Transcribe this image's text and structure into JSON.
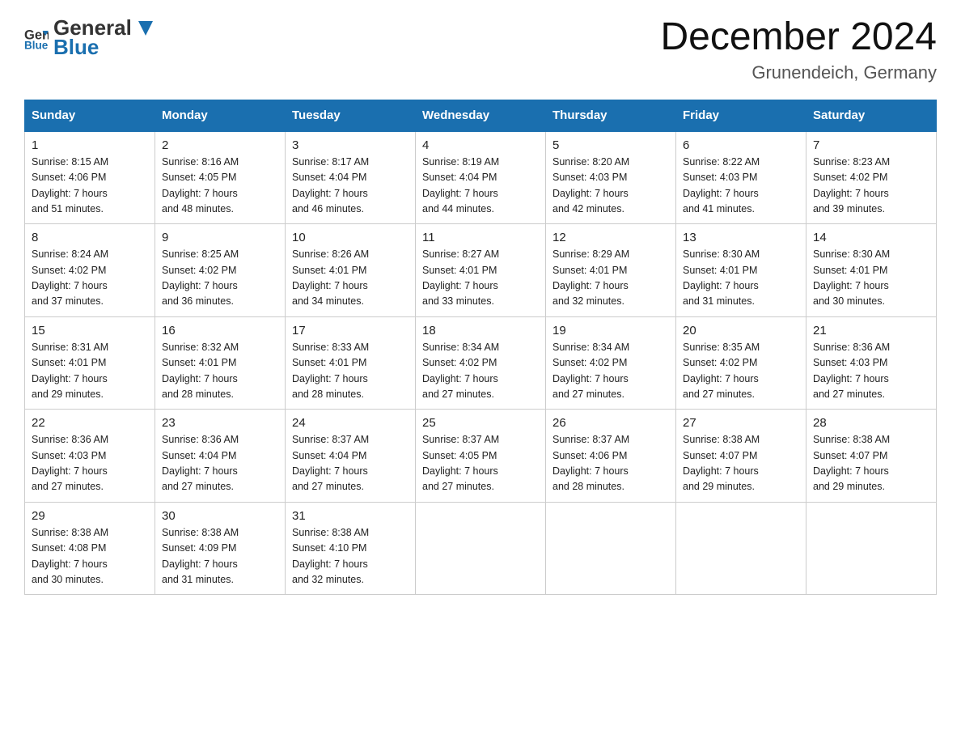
{
  "header": {
    "logo_general": "General",
    "logo_blue": "Blue",
    "month_title": "December 2024",
    "location": "Grunendeich, Germany"
  },
  "days_of_week": [
    "Sunday",
    "Monday",
    "Tuesday",
    "Wednesday",
    "Thursday",
    "Friday",
    "Saturday"
  ],
  "weeks": [
    [
      {
        "day": "1",
        "sunrise": "8:15 AM",
        "sunset": "4:06 PM",
        "daylight": "7 hours and 51 minutes."
      },
      {
        "day": "2",
        "sunrise": "8:16 AM",
        "sunset": "4:05 PM",
        "daylight": "7 hours and 48 minutes."
      },
      {
        "day": "3",
        "sunrise": "8:17 AM",
        "sunset": "4:04 PM",
        "daylight": "7 hours and 46 minutes."
      },
      {
        "day": "4",
        "sunrise": "8:19 AM",
        "sunset": "4:04 PM",
        "daylight": "7 hours and 44 minutes."
      },
      {
        "day": "5",
        "sunrise": "8:20 AM",
        "sunset": "4:03 PM",
        "daylight": "7 hours and 42 minutes."
      },
      {
        "day": "6",
        "sunrise": "8:22 AM",
        "sunset": "4:03 PM",
        "daylight": "7 hours and 41 minutes."
      },
      {
        "day": "7",
        "sunrise": "8:23 AM",
        "sunset": "4:02 PM",
        "daylight": "7 hours and 39 minutes."
      }
    ],
    [
      {
        "day": "8",
        "sunrise": "8:24 AM",
        "sunset": "4:02 PM",
        "daylight": "7 hours and 37 minutes."
      },
      {
        "day": "9",
        "sunrise": "8:25 AM",
        "sunset": "4:02 PM",
        "daylight": "7 hours and 36 minutes."
      },
      {
        "day": "10",
        "sunrise": "8:26 AM",
        "sunset": "4:01 PM",
        "daylight": "7 hours and 34 minutes."
      },
      {
        "day": "11",
        "sunrise": "8:27 AM",
        "sunset": "4:01 PM",
        "daylight": "7 hours and 33 minutes."
      },
      {
        "day": "12",
        "sunrise": "8:29 AM",
        "sunset": "4:01 PM",
        "daylight": "7 hours and 32 minutes."
      },
      {
        "day": "13",
        "sunrise": "8:30 AM",
        "sunset": "4:01 PM",
        "daylight": "7 hours and 31 minutes."
      },
      {
        "day": "14",
        "sunrise": "8:30 AM",
        "sunset": "4:01 PM",
        "daylight": "7 hours and 30 minutes."
      }
    ],
    [
      {
        "day": "15",
        "sunrise": "8:31 AM",
        "sunset": "4:01 PM",
        "daylight": "7 hours and 29 minutes."
      },
      {
        "day": "16",
        "sunrise": "8:32 AM",
        "sunset": "4:01 PM",
        "daylight": "7 hours and 28 minutes."
      },
      {
        "day": "17",
        "sunrise": "8:33 AM",
        "sunset": "4:01 PM",
        "daylight": "7 hours and 28 minutes."
      },
      {
        "day": "18",
        "sunrise": "8:34 AM",
        "sunset": "4:02 PM",
        "daylight": "7 hours and 27 minutes."
      },
      {
        "day": "19",
        "sunrise": "8:34 AM",
        "sunset": "4:02 PM",
        "daylight": "7 hours and 27 minutes."
      },
      {
        "day": "20",
        "sunrise": "8:35 AM",
        "sunset": "4:02 PM",
        "daylight": "7 hours and 27 minutes."
      },
      {
        "day": "21",
        "sunrise": "8:36 AM",
        "sunset": "4:03 PM",
        "daylight": "7 hours and 27 minutes."
      }
    ],
    [
      {
        "day": "22",
        "sunrise": "8:36 AM",
        "sunset": "4:03 PM",
        "daylight": "7 hours and 27 minutes."
      },
      {
        "day": "23",
        "sunrise": "8:36 AM",
        "sunset": "4:04 PM",
        "daylight": "7 hours and 27 minutes."
      },
      {
        "day": "24",
        "sunrise": "8:37 AM",
        "sunset": "4:04 PM",
        "daylight": "7 hours and 27 minutes."
      },
      {
        "day": "25",
        "sunrise": "8:37 AM",
        "sunset": "4:05 PM",
        "daylight": "7 hours and 27 minutes."
      },
      {
        "day": "26",
        "sunrise": "8:37 AM",
        "sunset": "4:06 PM",
        "daylight": "7 hours and 28 minutes."
      },
      {
        "day": "27",
        "sunrise": "8:38 AM",
        "sunset": "4:07 PM",
        "daylight": "7 hours and 29 minutes."
      },
      {
        "day": "28",
        "sunrise": "8:38 AM",
        "sunset": "4:07 PM",
        "daylight": "7 hours and 29 minutes."
      }
    ],
    [
      {
        "day": "29",
        "sunrise": "8:38 AM",
        "sunset": "4:08 PM",
        "daylight": "7 hours and 30 minutes."
      },
      {
        "day": "30",
        "sunrise": "8:38 AM",
        "sunset": "4:09 PM",
        "daylight": "7 hours and 31 minutes."
      },
      {
        "day": "31",
        "sunrise": "8:38 AM",
        "sunset": "4:10 PM",
        "daylight": "7 hours and 32 minutes."
      },
      null,
      null,
      null,
      null
    ]
  ],
  "labels": {
    "sunrise": "Sunrise:",
    "sunset": "Sunset:",
    "daylight": "Daylight:"
  }
}
